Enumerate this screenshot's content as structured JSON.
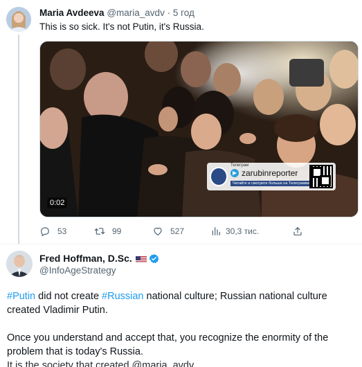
{
  "tweet1": {
    "author_name": "Maria Avdeeva",
    "handle": "@maria_avdv",
    "separator": "·",
    "time": "5 год",
    "text": "This is so sick. It's not Putin, it's Russia.",
    "video": {
      "duration": "0:02",
      "watermark_top": "Телеграм",
      "watermark_channel": "zarubinreporter",
      "watermark_sub": "Читайте и смотрите больше на Телеграмме"
    },
    "actions": {
      "replies": "53",
      "retweets": "99",
      "likes": "527",
      "views": "30,3 тис."
    },
    "icons": [
      "reply-icon",
      "retweet-icon",
      "like-icon",
      "views-icon",
      "share-icon"
    ]
  },
  "tweet2": {
    "author_name": "Fred Hoffman, D.Sc.",
    "handle": "@InfoAgeStrategy",
    "hashtag1": "#Putin",
    "text_a": " did not create ",
    "hashtag2": "#Russian",
    "text_b": " national culture; Russian national culture created Vladimir Putin.",
    "paragraph2": "Once you understand and accept that, you recognize the enormity of the problem that is today's Russia.",
    "paragraph3_partial": "It is the society that created @maria_avdv"
  },
  "colors": {
    "accent": "#1d9bf0",
    "secondary_text": "#536471",
    "primary_text": "#0f1419",
    "divider": "#eff3f4"
  }
}
